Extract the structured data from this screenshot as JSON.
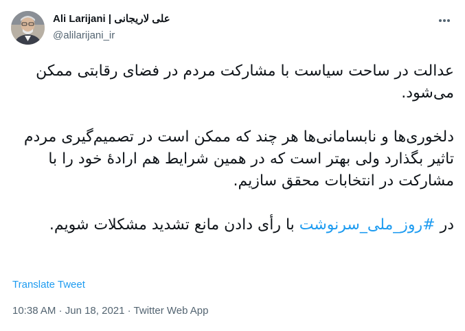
{
  "author": {
    "display_name": "Ali Larijani | علی لاریجانی",
    "handle": "@alilarijani_ir"
  },
  "more_icon": "more-horizontal-icon",
  "tweet": {
    "line_1_a": "عدالت در ساحت سیاست با مشارکت مردم در فضای رقابتی ممکن می‌شود.",
    "paragraph_2": "دلخوری‌ها و نابسامانی‌ها هر چند که ممکن است در تصمیم‌گیری مردم تاثیر بگذارد ولی بهتر است که در همین شرایط هم ارادهٔ خود را با مشارکت در انتخابات محقق سازیم.",
    "p3_prefix": "در ",
    "hashtag": "#روز_ملی_سرنوشت",
    "p3_suffix": " با رأی دادن مانع تشدید مشکلات شویم."
  },
  "translate_label": "Translate Tweet",
  "meta": {
    "time": "10:38 AM",
    "separator_1": " · ",
    "date": "Jun 18, 2021",
    "separator_2": " · ",
    "source": "Twitter Web App"
  },
  "colors": {
    "link": "#1d9bf0",
    "secondary": "#536471",
    "text": "#0f1419"
  }
}
